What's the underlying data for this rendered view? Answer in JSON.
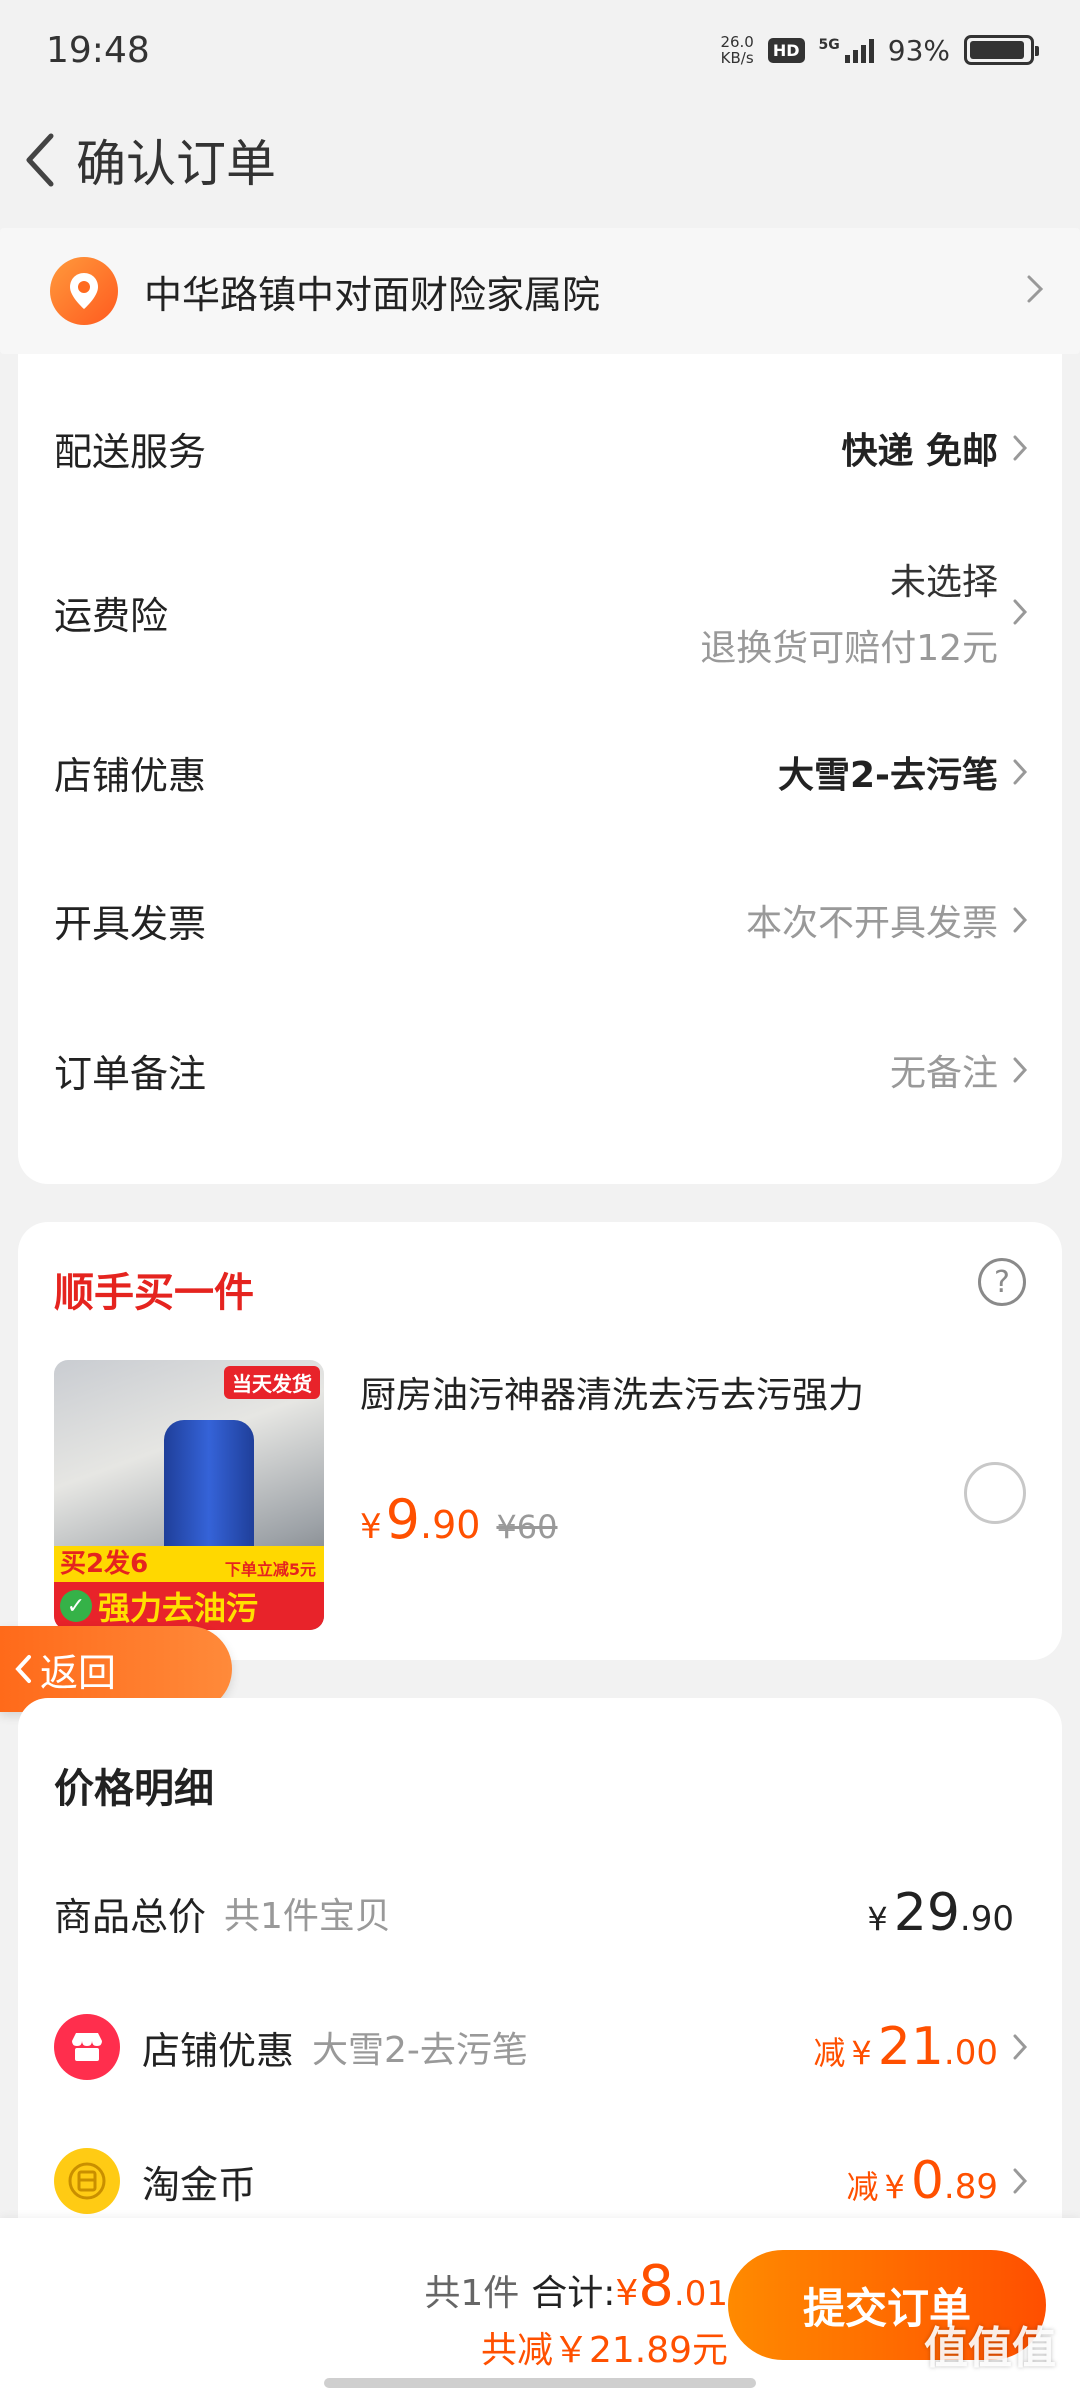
{
  "status_bar": {
    "time": "19:48",
    "net_speed_value": "26.0",
    "net_speed_unit": "KB/s",
    "hd": "HD",
    "network": "5G",
    "battery": "93%",
    "battery_level": 0.93
  },
  "header": {
    "title": "确认订单"
  },
  "address": {
    "text": "中华路镇中对面财险家属院"
  },
  "settings": {
    "delivery": {
      "label": "配送服务",
      "value": "快递 免邮"
    },
    "shipping_insurance": {
      "label": "运费险",
      "value": "未选择",
      "sub": "退换货可赔付12元"
    },
    "shop_discount": {
      "label": "店铺优惠",
      "value": "大雪2-去污笔"
    },
    "invoice": {
      "label": "开具发票",
      "value": "本次不开具发票"
    },
    "note": {
      "label": "订单备注",
      "value": "无备注"
    }
  },
  "addon": {
    "title": "顺手买一件",
    "help": "?",
    "product": {
      "name": "厨房油污神器清洗去污去污强力",
      "price_symbol": "¥",
      "price_int": "9",
      "price_dec": ".90",
      "original_price": "¥60",
      "img_tag": "当天发货",
      "img_promo": "买2发6",
      "img_sub": "下单立减5元",
      "img_slogan": "强力去油污"
    }
  },
  "back_button": {
    "label": "返回"
  },
  "price_detail": {
    "title": "价格明细",
    "goods_total": {
      "label": "商品总价",
      "sub": "共1件宝贝",
      "symbol": "¥",
      "int": "29",
      "dec": ".90"
    },
    "shop_discount": {
      "label": "店铺优惠",
      "sub": "大雪2-去污笔",
      "prefix": "减",
      "symbol": "¥",
      "int": "21",
      "dec": ".00"
    },
    "coins": {
      "label": "淘金币",
      "prefix": "减",
      "symbol": "¥",
      "int": "0",
      "dec": ".89"
    }
  },
  "footer": {
    "count": "共1件",
    "total_label": "合计:",
    "total_symbol": "¥",
    "total_int": "8",
    "total_dec": ".01",
    "saved": "共减￥21.89元",
    "submit": "提交订单",
    "watermark": "值值值"
  },
  "colors": {
    "accent": "#ff5000",
    "red": "#e5241f",
    "background": "#f2f2f2"
  }
}
